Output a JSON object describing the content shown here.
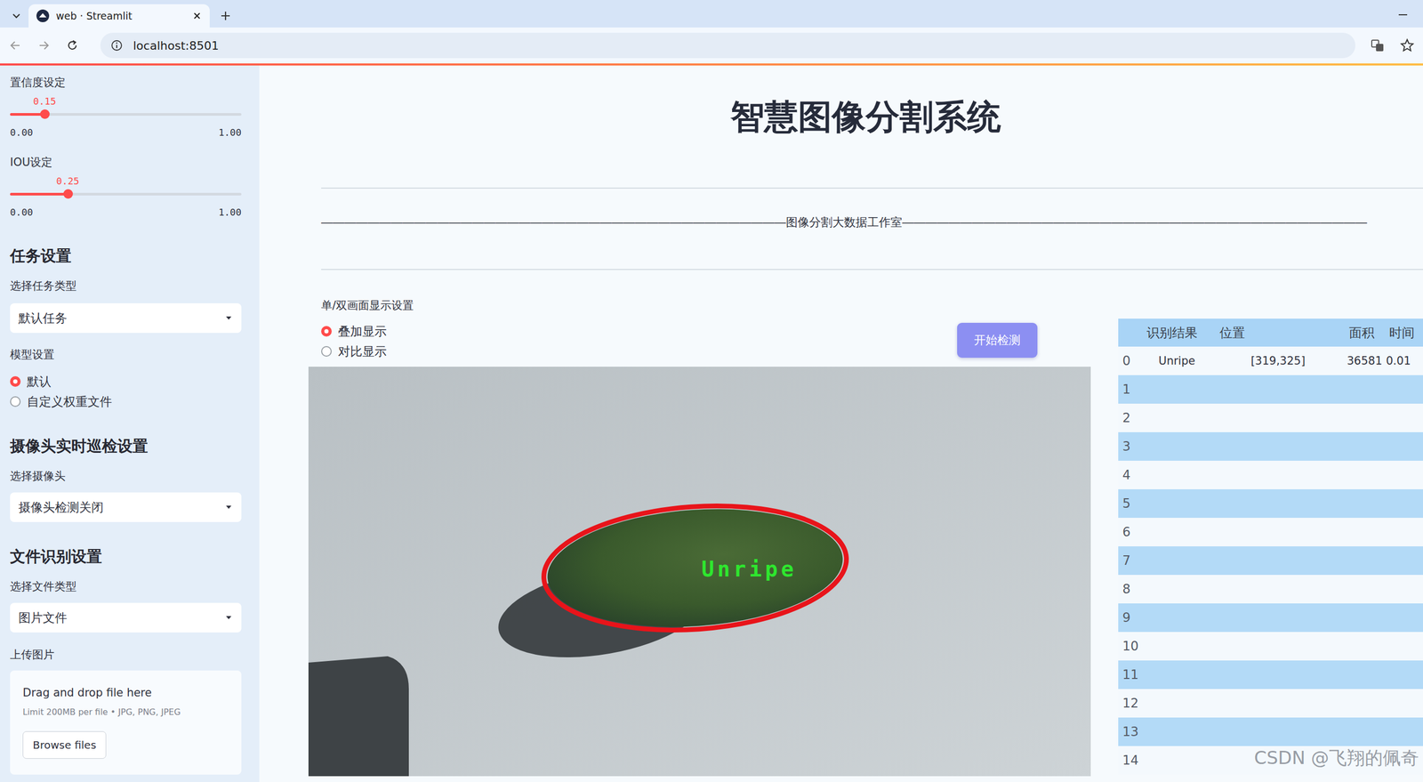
{
  "window": {
    "title": "web · Streamlit",
    "url": "localhost:8501"
  },
  "sidebar": {
    "sliders": [
      {
        "label": "置信度设定",
        "value": "0.15",
        "min": "0.00",
        "max": "1.00",
        "level": 0.15
      },
      {
        "label": "IOU设定",
        "value": "0.25",
        "min": "0.00",
        "max": "1.00",
        "level": 0.25
      }
    ],
    "task": {
      "heading": "任务设置",
      "select_label": "选择任务类型",
      "select_value": "默认任务"
    },
    "model": {
      "label": "模型设置",
      "options": [
        {
          "label": "默认",
          "selected": true
        },
        {
          "label": "自定义权重文件",
          "selected": false
        }
      ]
    },
    "camera": {
      "heading": "摄像头实时巡检设置",
      "select_label": "选择摄像头",
      "select_value": "摄像头检测关闭"
    },
    "file": {
      "heading": "文件识别设置",
      "select_label": "选择文件类型",
      "select_value": "图片文件"
    },
    "upload": {
      "label": "上传图片",
      "drop_text": "Drag and drop file here",
      "limit_text": "Limit 200MB per file • JPG, PNG, JPEG",
      "button": "Browse files"
    }
  },
  "main": {
    "title": "智慧图像分割系统",
    "divider": "————————————————————————————————————————图像分割大数据工作室————————————————————————————————————————",
    "display": {
      "label": "单/双画面显示设置",
      "options": [
        {
          "label": "叠加显示",
          "selected": true
        },
        {
          "label": "对比显示",
          "selected": false
        }
      ]
    },
    "start_button": "开始检测",
    "image": {
      "detections": [
        {
          "label": "Unripe"
        }
      ]
    },
    "table": {
      "columns": [
        "识别结果",
        "位置",
        "面积",
        "时间"
      ],
      "rows": [
        {
          "index": "0",
          "cells": [
            "Unripe",
            "[319,325]",
            "36581",
            "0.01"
          ]
        },
        {
          "index": "1",
          "cells": [
            "",
            "",
            "",
            ""
          ]
        },
        {
          "index": "2",
          "cells": [
            "",
            "",
            "",
            ""
          ]
        },
        {
          "index": "3",
          "cells": [
            "",
            "",
            "",
            ""
          ]
        },
        {
          "index": "4",
          "cells": [
            "",
            "",
            "",
            ""
          ]
        },
        {
          "index": "5",
          "cells": [
            "",
            "",
            "",
            ""
          ]
        },
        {
          "index": "6",
          "cells": [
            "",
            "",
            "",
            ""
          ]
        },
        {
          "index": "7",
          "cells": [
            "",
            "",
            "",
            ""
          ]
        },
        {
          "index": "8",
          "cells": [
            "",
            "",
            "",
            ""
          ]
        },
        {
          "index": "9",
          "cells": [
            "",
            "",
            "",
            ""
          ]
        },
        {
          "index": "10",
          "cells": [
            "",
            "",
            "",
            ""
          ]
        },
        {
          "index": "11",
          "cells": [
            "",
            "",
            "",
            ""
          ]
        },
        {
          "index": "12",
          "cells": [
            "",
            "",
            "",
            ""
          ]
        },
        {
          "index": "13",
          "cells": [
            "",
            "",
            "",
            ""
          ]
        },
        {
          "index": "14",
          "cells": [
            "",
            "",
            "",
            ""
          ]
        }
      ]
    },
    "watermark": "CSDN @飞翔的佩奇"
  }
}
